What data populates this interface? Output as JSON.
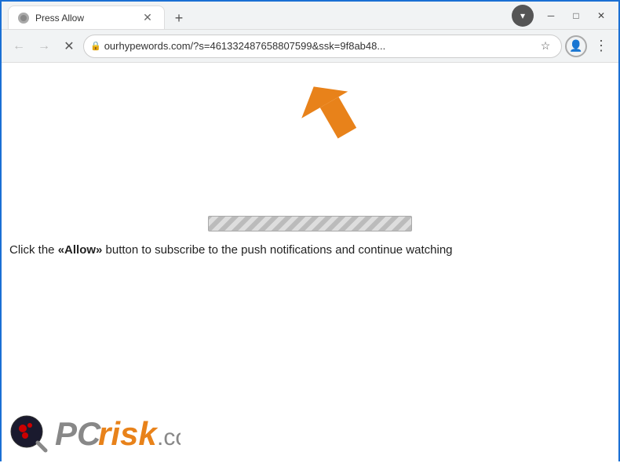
{
  "titlebar": {
    "tab_title": "Press Allow",
    "new_tab_label": "+",
    "minimize_label": "─",
    "maximize_label": "□",
    "close_label": "✕"
  },
  "addressbar": {
    "back_label": "←",
    "forward_label": "→",
    "reload_label": "✕",
    "url": "ourhypewords.com/?s=461332487658807599&ssk=9f8ab48...",
    "lock_icon": "🔒",
    "star_icon": "☆",
    "profile_icon": "👤",
    "menu_icon": "⋮"
  },
  "content": {
    "instruction_text_prefix": "Click the ",
    "instruction_allow": "«Allow»",
    "instruction_text_suffix": " button to subscribe to the push notifications and continue watching"
  },
  "pcrisk": {
    "text": "PC",
    "risk": "risk",
    "dotcom": ".com"
  }
}
